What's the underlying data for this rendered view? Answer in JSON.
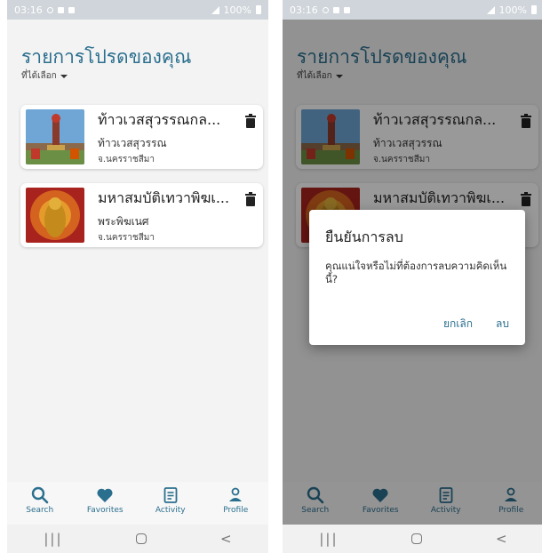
{
  "status": {
    "time": "03:16",
    "battery": "100%"
  },
  "header": {
    "title": "รายการโปรดของคุณ",
    "filter_label": "ที่ได้เลือก"
  },
  "favorites": [
    {
      "title": "ท้าวเวสสุวรรณกล...",
      "subtitle": "ท้าวเวสสุวรรณ",
      "location": "จ.นครราชสีมา"
    },
    {
      "title": "มหาสมบัติเทวาพิฆเ...",
      "subtitle": "พระพิฆเนศ",
      "location": "จ.นครราชสีมา"
    }
  ],
  "nav": {
    "search": "Search",
    "favorites": "Favorites",
    "activity": "Activity",
    "profile": "Profile"
  },
  "sysnav": {
    "recent": "|||",
    "back": "<"
  },
  "dialog": {
    "title": "ยืนยันการลบ",
    "message": "คุณแน่ใจหรือไม่ที่ต้องการลบความคิดเห็นนี้?",
    "cancel": "ยกเลิก",
    "confirm": "ลบ"
  },
  "colors": {
    "accent": "#2b6f8e",
    "statusbar": "#cfd5da",
    "background": "#f3f3f3"
  },
  "icons": {
    "search": "search-icon",
    "favorites": "heart-icon",
    "activity": "document-icon",
    "profile": "person-icon",
    "delete": "trash-icon"
  }
}
